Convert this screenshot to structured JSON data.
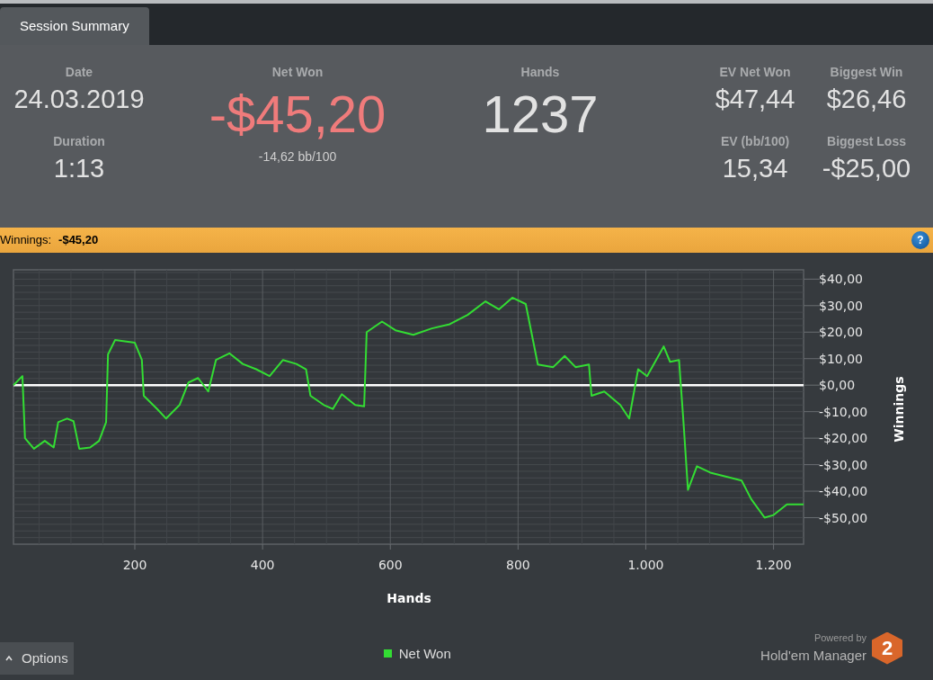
{
  "tabs": [
    {
      "label": "Session Summary",
      "selected": true
    }
  ],
  "summary": {
    "date": {
      "label": "Date",
      "value": "24.03.2019"
    },
    "duration": {
      "label": "Duration",
      "value": "1:13"
    },
    "net_won": {
      "label": "Net Won",
      "value": "-$45,20",
      "sub": "-14,62 bb/100"
    },
    "hands": {
      "label": "Hands",
      "value": "1237"
    },
    "ev_net_won": {
      "label": "EV Net Won",
      "value": "$47,44"
    },
    "biggest_win": {
      "label": "Biggest Win",
      "value": "$26,46"
    },
    "ev_bb100": {
      "label": "EV (bb/100)",
      "value": "15,34"
    },
    "biggest_loss": {
      "label": "Biggest Loss",
      "value": "-$25,00"
    }
  },
  "winnings_bar": {
    "label": "Winnings:",
    "value": "-$45,20",
    "help": "?"
  },
  "chart": {
    "chart_data": {
      "type": "line",
      "xlabel": "Hands",
      "ylabel": "Winnings",
      "x": [
        10,
        24,
        28,
        42,
        59,
        73,
        80,
        94,
        104,
        113,
        130,
        144,
        155,
        158,
        169,
        200,
        211,
        214,
        235,
        249,
        270,
        284,
        299,
        315,
        327,
        348,
        369,
        390,
        411,
        432,
        453,
        468,
        475,
        496,
        510,
        524,
        545,
        559,
        563,
        587,
        608,
        636,
        665,
        693,
        721,
        749,
        770,
        791,
        812,
        831,
        855,
        873,
        890,
        911,
        915,
        935,
        960,
        974,
        988,
        1002,
        1028,
        1038,
        1052,
        1059,
        1066,
        1080,
        1101,
        1129,
        1150,
        1165,
        1186,
        1200,
        1221,
        1247
      ],
      "series": [
        {
          "name": "Net Won",
          "color": "#33dd33",
          "values": [
            0,
            3.4,
            -20,
            -24,
            -21,
            -23.5,
            -14,
            -12.6,
            -13.6,
            -24,
            -23.5,
            -21,
            -14,
            11.6,
            17,
            16,
            9.5,
            -4,
            -9,
            -12.6,
            -7.5,
            1,
            2.7,
            -2.4,
            9.5,
            12,
            8,
            6,
            3.4,
            9.5,
            8,
            6,
            -4,
            -7.5,
            -9,
            -3.4,
            -7.5,
            -8,
            20,
            24,
            20.7,
            19,
            21.4,
            23,
            26.5,
            31.6,
            28.6,
            33,
            30.6,
            7.8,
            6.8,
            11,
            6.8,
            7.8,
            -4,
            -2.4,
            -7.5,
            -12.6,
            6,
            3.4,
            14.6,
            8.8,
            9.5,
            -14,
            -39.5,
            -30.6,
            -33,
            -34.7,
            -36,
            -43,
            -50,
            -49,
            -45,
            -45
          ]
        }
      ],
      "xlim": [
        10,
        1247
      ],
      "ylim": [
        -60,
        43.5
      ],
      "xticks": [
        {
          "value": 200,
          "label": "200"
        },
        {
          "value": 400,
          "label": "400"
        },
        {
          "value": 600,
          "label": "600"
        },
        {
          "value": 800,
          "label": "800"
        },
        {
          "value": 1000,
          "label": "1.000"
        },
        {
          "value": 1200,
          "label": "1.200"
        }
      ],
      "yticks": [
        {
          "value": 40,
          "label": "$40,00"
        },
        {
          "value": 30,
          "label": "$30,00"
        },
        {
          "value": 20,
          "label": "$20,00"
        },
        {
          "value": 10,
          "label": "$10,00"
        },
        {
          "value": 0,
          "label": "$0,00"
        },
        {
          "value": -10,
          "label": "-$10,00"
        },
        {
          "value": -20,
          "label": "-$20,00"
        },
        {
          "value": -30,
          "label": "-$30,00"
        },
        {
          "value": -40,
          "label": "-$40,00"
        },
        {
          "value": -50,
          "label": "-$50,00"
        }
      ],
      "grid": true,
      "ref_lines": [
        {
          "axis": "y",
          "value": 0
        }
      ]
    }
  },
  "footer": {
    "options_button": "Options",
    "powered_by": "Powered by",
    "brand": "Hold'em Manager",
    "logo_text": "2"
  }
}
